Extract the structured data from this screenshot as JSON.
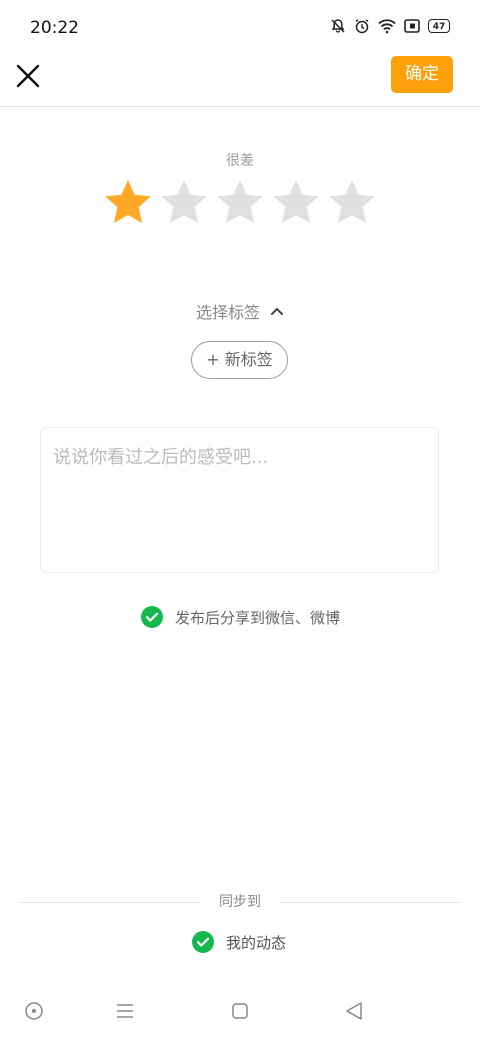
{
  "status_bar": {
    "time": "20:22",
    "battery": "47",
    "icons": [
      "bell-mute-icon",
      "alarm-icon",
      "wifi-icon",
      "sim-icon",
      "battery-icon"
    ]
  },
  "header": {
    "close_icon": "close-icon",
    "confirm_label": "确定",
    "accent_color": "#ff9f0a"
  },
  "rating": {
    "label": "很差",
    "value": 1,
    "max": 5,
    "filled_color": "#ffa726",
    "empty_color": "#e0e0e0"
  },
  "tags": {
    "toggle_label": "选择标签",
    "toggle_icon": "chevron-up-icon",
    "new_tag_label": "+ 新标签"
  },
  "comment": {
    "placeholder": "说说你看过之后的感受吧..."
  },
  "share": {
    "label": "发布后分享到微信、微博",
    "checked": true,
    "check_color": "#16b84e"
  },
  "sync": {
    "title": "同步到",
    "items": [
      {
        "label": "我的动态",
        "checked": true
      }
    ]
  },
  "nav": {
    "icons": [
      "assistant-icon",
      "menu-icon",
      "home-square-icon",
      "back-triangle-icon"
    ]
  }
}
